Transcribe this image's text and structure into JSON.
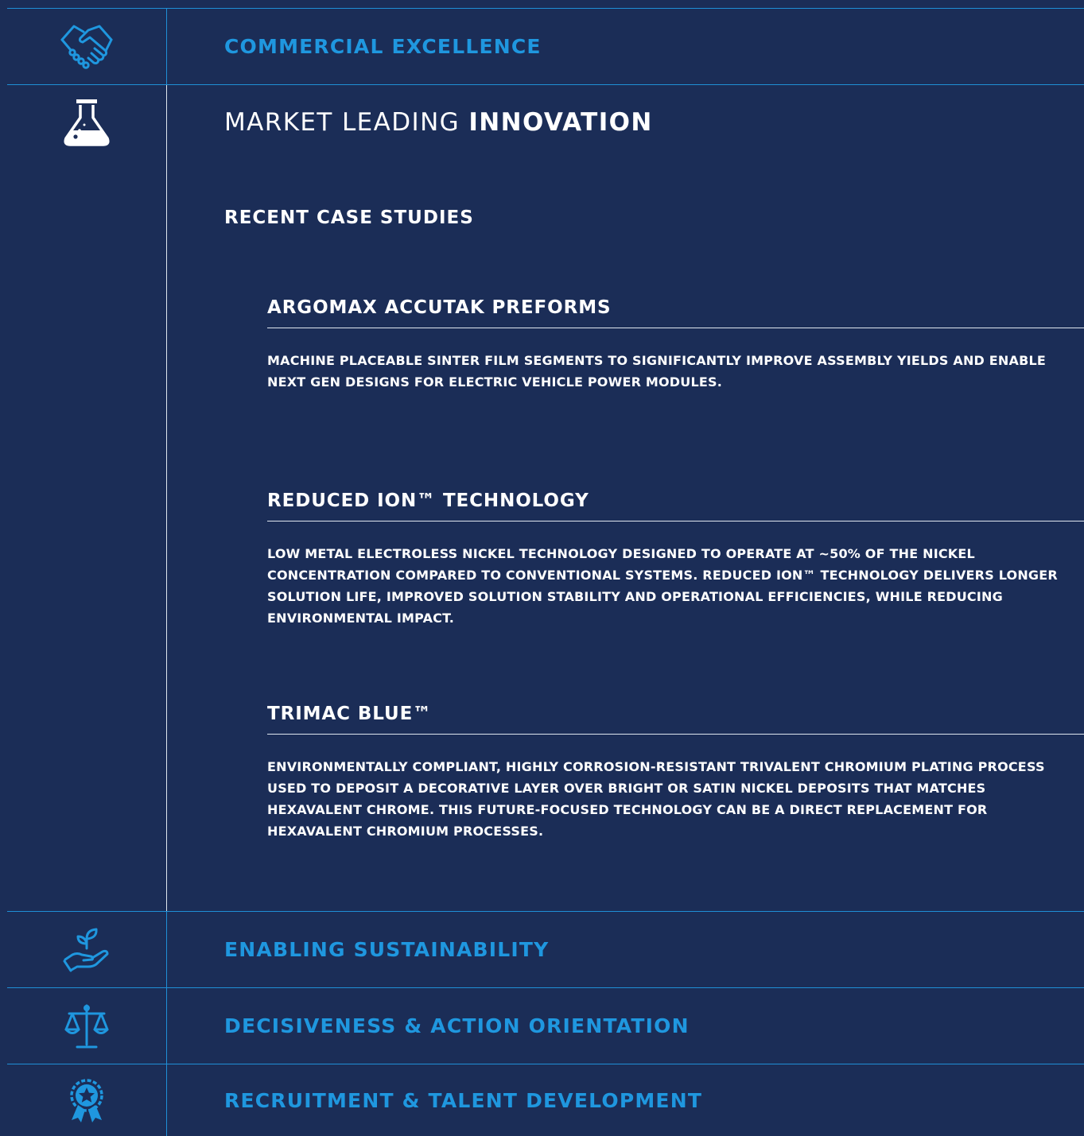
{
  "rows": {
    "commercial": {
      "label": "COMMERCIAL EXCELLENCE",
      "icon": "handshake-icon"
    },
    "sustainability": {
      "label": "ENABLING SUSTAINABILITY",
      "icon": "plant-hand-icon"
    },
    "decisiveness": {
      "label": "DECISIVENESS & ACTION ORIENTATION",
      "icon": "scales-icon"
    },
    "recruitment": {
      "label": "RECRUITMENT & TALENT DEVELOPMENT",
      "icon": "award-ribbon-icon"
    }
  },
  "innovation": {
    "icon": "flask-icon",
    "title_light": "MARKET LEADING ",
    "title_bold": "INNOVATION",
    "subheading": "RECENT CASE STUDIES",
    "cases": [
      {
        "title": "ARGOMAX ACCUTAK PREFORMS",
        "description": "MACHINE PLACEABLE SINTER FILM SEGMENTS TO SIGNIFICANTLY IMPROVE ASSEMBLY YIELDS AND ENABLE NEXT GEN DESIGNS FOR ELECTRIC VEHICLE POWER MODULES."
      },
      {
        "title": "REDUCED ION™ TECHNOLOGY",
        "description": "LOW METAL ELECTROLESS NICKEL TECHNOLOGY DESIGNED TO OPERATE AT ~50% OF THE NICKEL CONCENTRATION COMPARED TO CONVENTIONAL SYSTEMS. REDUCED ION™ TECHNOLOGY DELIVERS LONGER SOLUTION LIFE, IMPROVED SOLUTION STABILITY AND OPERATIONAL EFFICIENCIES, WHILE REDUCING ENVIRONMENTAL IMPACT."
      },
      {
        "title": "TRIMAC BLUE™",
        "description": "ENVIRONMENTALLY COMPLIANT, HIGHLY CORROSION-RESISTANT TRIVALENT CHROMIUM PLATING PROCESS USED TO DEPOSIT A DECORATIVE LAYER OVER BRIGHT OR SATIN NICKEL DEPOSITS THAT MATCHES HEXAVALENT CHROME. THIS FUTURE-FOCUSED TECHNOLOGY CAN BE A DIRECT REPLACEMENT FOR HEXAVALENT CHROMIUM PROCESSES."
      }
    ]
  },
  "colors": {
    "background": "#1b2d57",
    "accent": "#1f97df",
    "text": "#ffffff"
  }
}
